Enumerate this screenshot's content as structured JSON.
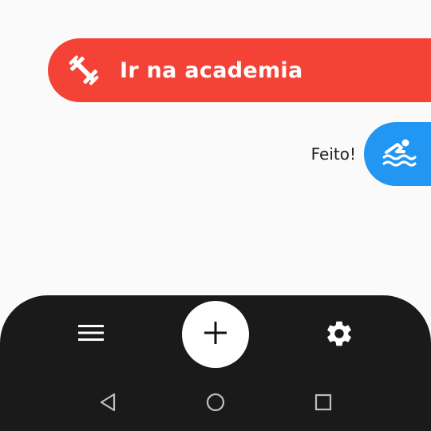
{
  "colors": {
    "background": "#fafafa",
    "habit_pill": "#f44336",
    "done_pill": "#2196f3",
    "bottom_bar": "#1a1a1a",
    "fab": "#ffffff",
    "icon_light": "#ffffff",
    "icon_dark": "#111111",
    "sys_icon": "#bdbdbd",
    "done_text": "#222222"
  },
  "habit": {
    "label": "Ir na academia",
    "icon": "dumbbell-icon"
  },
  "done": {
    "label": "Feito!",
    "icon": "swimming-icon"
  },
  "bottom_bar": {
    "menu_icon": "hamburger-menu-icon",
    "fab_icon": "plus-icon",
    "settings_icon": "gear-icon"
  },
  "system_nav": {
    "back_icon": "triangle-back-icon",
    "home_icon": "circle-home-icon",
    "recent_icon": "square-recent-icon"
  }
}
